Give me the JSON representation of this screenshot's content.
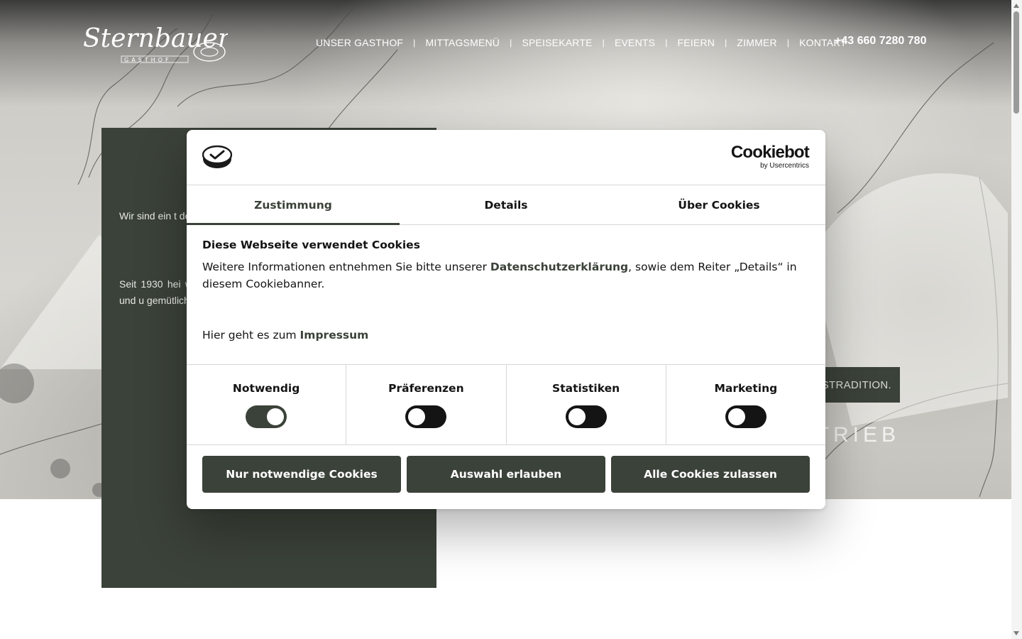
{
  "header": {
    "logo_text": "Sternbauer",
    "logo_subtext": "GASTHOF",
    "nav": [
      "UNSER GASTHOF",
      "MITTAGSMENÜ",
      "SPEISEKARTE",
      "EVENTS",
      "FEIERN",
      "ZIMMER",
      "KONTAKT"
    ],
    "nav_separator": "|",
    "phone": "+43 660 7280 780"
  },
  "hero": {
    "badge_text": "USTRADITION.",
    "subtitle_text": "TRIEB"
  },
  "intro": {
    "paragraph_1": "Wir sind ein t der vierten Ger wird.",
    "paragraph_2": "Seit 1930 hei willkommen u familiäre Atmo Mittelpunkt – fühlen und u gemütlichen A besondere Feie zu dürfen."
  },
  "cookie_dialog": {
    "brand": "Cookiebot",
    "brand_by": "by Usercentrics",
    "tabs": [
      "Zustimmung",
      "Details",
      "Über Cookies"
    ],
    "active_tab": "Zustimmung",
    "title": "Diese Webseite verwendet Cookies",
    "text_before_link": "Weitere Informationen entnehmen Sie bitte unserer ",
    "privacy_link": "Datenschutzerklärung",
    "text_after_link": ", sowie dem Reiter „Details“ in diesem Cookiebanner.",
    "imprint_prefix": "Hier geht es zum ",
    "imprint_link": "Impressum",
    "categories": [
      {
        "label": "Notwendig",
        "checked": true
      },
      {
        "label": "Präferenzen",
        "checked": false
      },
      {
        "label": "Statistiken",
        "checked": false
      },
      {
        "label": "Marketing",
        "checked": false
      }
    ],
    "buttons": [
      "Nur notwendige Cookies",
      "Auswahl erlauben",
      "Alle Cookies zulassen"
    ]
  },
  "colors": {
    "accent": "#3b4239",
    "toggle_off": "#141414",
    "text": "#141414"
  }
}
